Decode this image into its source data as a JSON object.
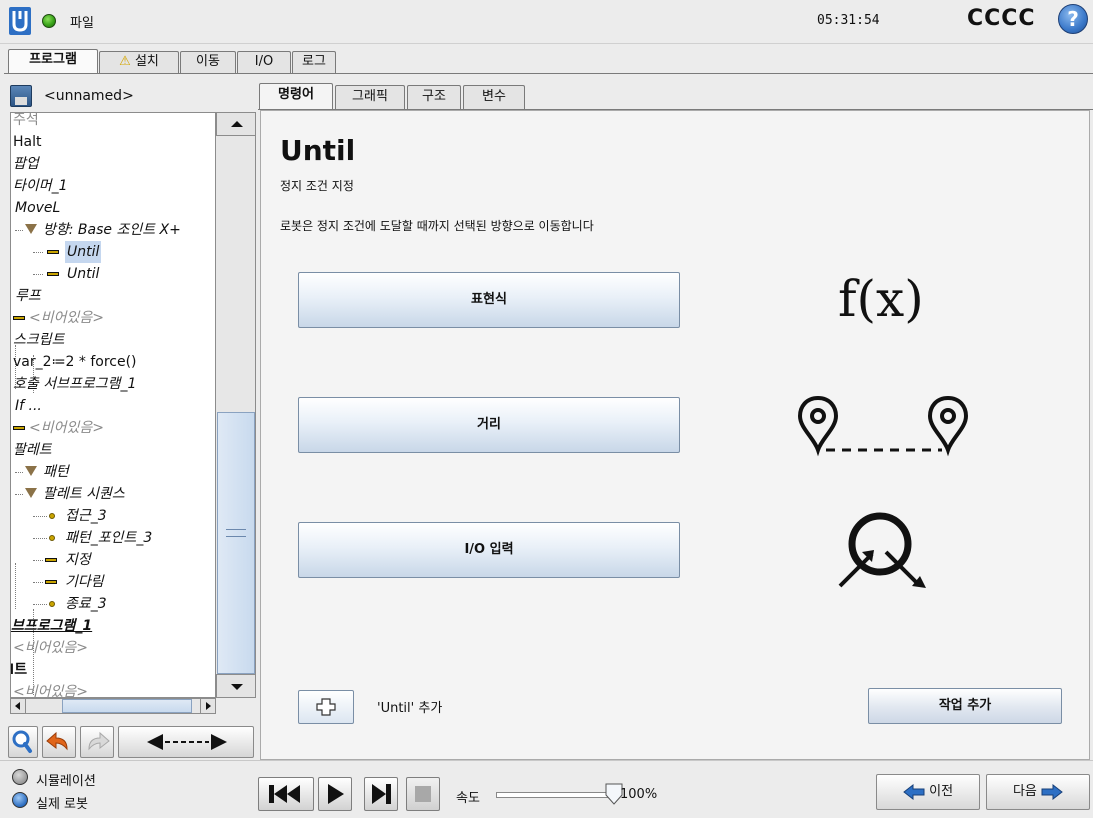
{
  "header": {
    "file_label": "파일",
    "clock": "05:31:54",
    "robot_name": "CCCC",
    "help_glyph": "?"
  },
  "main_tabs": [
    {
      "label": "프로그램",
      "active": true
    },
    {
      "label": "설치",
      "warning": "⚠"
    },
    {
      "label": "이동"
    },
    {
      "label": "I/O"
    },
    {
      "label": "로그"
    }
  ],
  "program": {
    "name": "<unnamed>"
  },
  "tree": {
    "items": [
      {
        "label": "주석",
        "style": "gray"
      },
      {
        "label": "Halt"
      },
      {
        "label": "팝업",
        "style": "italic"
      },
      {
        "label": "타이머_1",
        "style": "italic"
      },
      {
        "label": "MoveL",
        "style": "italic"
      },
      {
        "label": "방향: Base 조인트 X+",
        "style": "italic",
        "icon": "triangle"
      },
      {
        "label": "Until",
        "style": "italic",
        "icon": "bar",
        "selected": true
      },
      {
        "label": "Until",
        "style": "italic",
        "icon": "bar"
      },
      {
        "label": "루프",
        "style": "italic"
      },
      {
        "label": "<비어있음>",
        "style": "gray",
        "icon": "bar-yellow"
      },
      {
        "label": "스크립트",
        "style": "italic"
      },
      {
        "label": "var_2≔2 * force()"
      },
      {
        "label": "호출 서브프로그램_1",
        "style": "italic"
      },
      {
        "label": "If ...",
        "style": "italic"
      },
      {
        "label": "<비어있음>",
        "style": "gray",
        "icon": "bar-yellow"
      },
      {
        "label": "팔레트",
        "style": "italic"
      },
      {
        "label": "패턴",
        "style": "italic",
        "icon": "triangle"
      },
      {
        "label": "팔레트 시퀀스",
        "style": "italic",
        "icon": "triangle"
      },
      {
        "label": "접근_3",
        "style": "italic",
        "icon": "dot"
      },
      {
        "label": "패턴_포인트_3",
        "style": "italic",
        "icon": "dot"
      },
      {
        "label": "지정",
        "style": "italic",
        "icon": "bar"
      },
      {
        "label": "기다림",
        "style": "italic",
        "icon": "bar"
      },
      {
        "label": "종료_3",
        "style": "italic",
        "icon": "dot"
      },
      {
        "label": "브프로그램_1",
        "style": "bold-italic"
      },
      {
        "label": "<비어있음>",
        "style": "gray"
      },
      {
        "label": "I트",
        "style": "bold"
      },
      {
        "label": "<비어있음>",
        "style": "gray"
      }
    ]
  },
  "sub_tabs": [
    {
      "label": "명령어",
      "active": true
    },
    {
      "label": "그래픽"
    },
    {
      "label": "구조"
    },
    {
      "label": "변수"
    }
  ],
  "until": {
    "title": "Until",
    "subtitle": "정지 조건 지정",
    "description": "로봇은 정지 조건에 도달할 때까지 선택된 방향으로 이동합니다",
    "buttons": {
      "expression": "표현식",
      "distance": "거리",
      "io_input": "I/O 입력"
    },
    "fx_label": "f(x)",
    "add_until_label": "'Until' 추가",
    "add_action_label": "작업 추가"
  },
  "footer": {
    "simulation_label": "시뮬레이션",
    "real_robot_label": "실제 로봇",
    "speed_label": "속도",
    "speed_value": "100%",
    "speed_fraction": 1.0,
    "prev_label": "이전",
    "next_label": "다음"
  },
  "colors": {
    "accent_blue": "#3a78c9",
    "status_green": "#3aa41a",
    "warning_yellow": "#f2c200",
    "selected_row": "#c5d7ef"
  }
}
